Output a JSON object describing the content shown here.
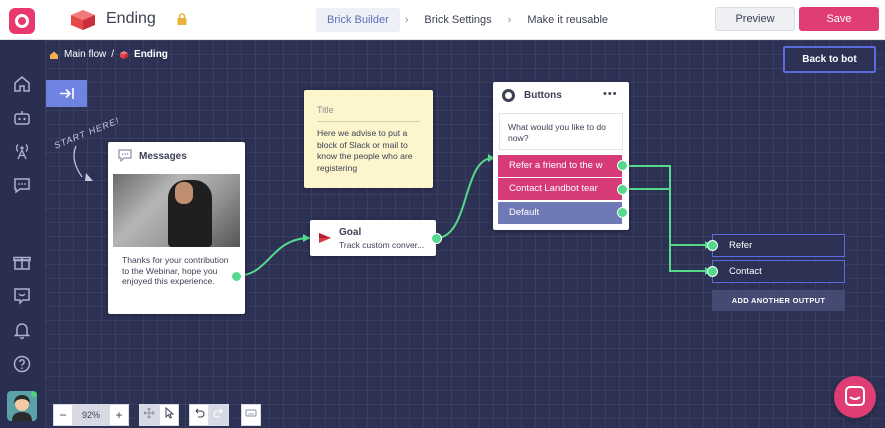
{
  "header": {
    "title": "Ending",
    "tabs": [
      {
        "label": "Brick Builder",
        "active": true
      },
      {
        "label": "Brick Settings",
        "active": false
      },
      {
        "label": "Make it reusable",
        "active": false
      }
    ],
    "separator": "›",
    "preview_label": "Preview",
    "save_label": "Save"
  },
  "breadcrumb": {
    "root": "Main flow",
    "separator": "/",
    "current": "Ending"
  },
  "canvas": {
    "back_label": "Back to bot",
    "start_note": "START HERE!"
  },
  "messages_card": {
    "title": "Messages",
    "text": "Thanks for your contribution to the Webinar, hope you enjoyed this experience."
  },
  "note_card": {
    "title": "Title",
    "text": "Here we advise to put a block of Slack or mail to know the people who are registering"
  },
  "goal_card": {
    "title": "Goal",
    "subtitle": "Track custom conver..."
  },
  "buttons_card": {
    "title": "Buttons",
    "menu": "•••",
    "question": "What would you like to do now?",
    "options": [
      {
        "label": "Refer a friend to the w"
      },
      {
        "label": "Contact Landbot tear"
      },
      {
        "label": "Default"
      }
    ]
  },
  "outputs": {
    "items": [
      "Refer",
      "Contact"
    ],
    "add_label": "ADD ANOTHER OUTPUT"
  },
  "toolbar": {
    "zoom_out": "−",
    "zoom_value": "92%",
    "zoom_in": "+"
  },
  "colors": {
    "brand": "#e8386e",
    "save": "#e03d74",
    "canvas": "#2d3154",
    "wire": "#55d98d",
    "option_pink": "#d63a78",
    "option_violet": "#6f79b5",
    "accent_blue": "#5a6be0"
  },
  "icons": {
    "brand": "landbot-logo-icon",
    "brick": "brick-cube-icon",
    "lock": "lock-icon",
    "home": "home-icon",
    "bot": "bot-icon",
    "broadcast": "antenna-icon",
    "chat": "chat-icon",
    "gift": "gift-icon",
    "feedback": "feedback-icon",
    "bell": "bell-icon",
    "help": "help-icon",
    "collapse": "collapse-arrow-icon",
    "messages": "speech-bubble-icon",
    "goal": "flag-icon",
    "buttons": "radio-icon",
    "move": "move-icon",
    "pointer": "pointer-icon",
    "undo": "undo-icon",
    "redo": "redo-icon",
    "keyboard": "keyboard-icon",
    "support": "support-chat-icon"
  }
}
